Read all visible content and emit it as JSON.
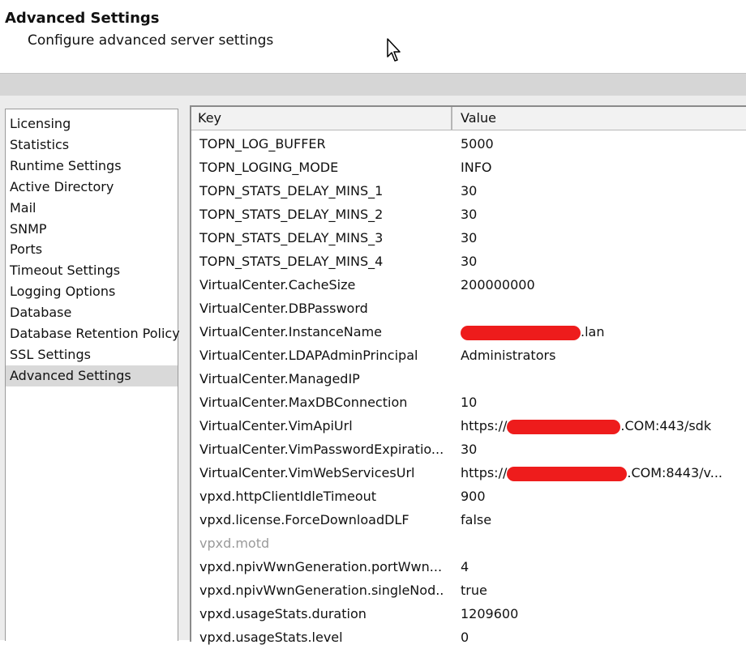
{
  "header": {
    "title": "Advanced Settings",
    "subtitle": "Configure advanced server settings"
  },
  "sidebar": {
    "items": [
      {
        "label": "Licensing"
      },
      {
        "label": "Statistics"
      },
      {
        "label": "Runtime Settings"
      },
      {
        "label": "Active Directory"
      },
      {
        "label": "Mail"
      },
      {
        "label": "SNMP"
      },
      {
        "label": "Ports"
      },
      {
        "label": "Timeout Settings"
      },
      {
        "label": "Logging Options"
      },
      {
        "label": "Database"
      },
      {
        "label": "Database Retention Policy"
      },
      {
        "label": "SSL Settings"
      },
      {
        "label": "Advanced Settings",
        "selected": true
      }
    ]
  },
  "table": {
    "columns": {
      "key": "Key",
      "value": "Value"
    },
    "rows": [
      {
        "key": "TOPN_LOG_BUFFER",
        "value": "5000"
      },
      {
        "key": "TOPN_LOGING_MODE",
        "value": "INFO"
      },
      {
        "key": "TOPN_STATS_DELAY_MINS_1",
        "value": "30"
      },
      {
        "key": "TOPN_STATS_DELAY_MINS_2",
        "value": "30"
      },
      {
        "key": "TOPN_STATS_DELAY_MINS_3",
        "value": "30"
      },
      {
        "key": "TOPN_STATS_DELAY_MINS_4",
        "value": "30"
      },
      {
        "key": "VirtualCenter.CacheSize",
        "value": "200000000"
      },
      {
        "key": "VirtualCenter.DBPassword",
        "value": ""
      },
      {
        "key": "VirtualCenter.InstanceName",
        "value_prefix": "",
        "value_suffix": ".lan",
        "redacted": true
      },
      {
        "key": "VirtualCenter.LDAPAdminPrincipal",
        "value": "Administrators"
      },
      {
        "key": "VirtualCenter.ManagedIP",
        "value": ""
      },
      {
        "key": "VirtualCenter.MaxDBConnection",
        "value": "10"
      },
      {
        "key": "VirtualCenter.VimApiUrl",
        "value_prefix": "https://",
        "value_suffix": ".COM:443/sdk",
        "redacted": true
      },
      {
        "key": "VirtualCenter.VimPasswordExpiratio...",
        "value": "30"
      },
      {
        "key": "VirtualCenter.VimWebServicesUrl",
        "value_prefix": "https://",
        "value_suffix": ".COM:8443/v...",
        "redacted": true
      },
      {
        "key": "vpxd.httpClientIdleTimeout",
        "value": "900"
      },
      {
        "key": "vpxd.license.ForceDownloadDLF",
        "value": "false"
      },
      {
        "key": "vpxd.motd",
        "value": "",
        "disabled": true
      },
      {
        "key": "vpxd.npivWwnGeneration.portWwn...",
        "value": "4"
      },
      {
        "key": "vpxd.npivWwnGeneration.singleNod...",
        "value": "true"
      },
      {
        "key": "vpxd.usageStats.duration",
        "value": "1209600"
      },
      {
        "key": "vpxd.usageStats.level",
        "value": "0"
      }
    ]
  },
  "colors": {
    "redaction": "#ee1c1c",
    "selected_bg": "#d9d9d9",
    "band": "#d6d6d6"
  },
  "icons": {
    "cursor": "mouse-pointer-icon"
  }
}
